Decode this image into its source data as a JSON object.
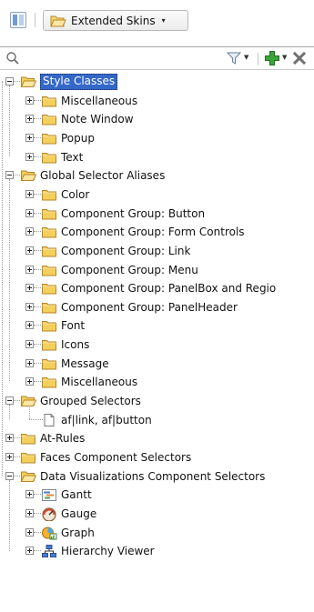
{
  "toolbar": {
    "skin_label": "Extended Skins",
    "dropdown_caret": "▾"
  },
  "search": {
    "placeholder": "",
    "value": ""
  },
  "colors": {
    "selection": "#3468c8",
    "folder": "#f0c64a",
    "add": "#2f9a2f",
    "delete": "#6f6f6f"
  },
  "tree": [
    {
      "label": "Style Classes",
      "level": 0,
      "expander": "minus",
      "icon": "folder-open-icon",
      "selected": true
    },
    {
      "label": "Miscellaneous",
      "level": 1,
      "expander": "plus",
      "icon": "folder-icon"
    },
    {
      "label": "Note Window",
      "level": 1,
      "expander": "plus",
      "icon": "folder-icon"
    },
    {
      "label": "Popup",
      "level": 1,
      "expander": "plus",
      "icon": "folder-icon"
    },
    {
      "label": "Text",
      "level": 1,
      "expander": "plus",
      "icon": "folder-icon"
    },
    {
      "label": "Global Selector Aliases",
      "level": 0,
      "expander": "minus",
      "icon": "folder-open-icon"
    },
    {
      "label": "Color",
      "level": 1,
      "expander": "plus",
      "icon": "folder-icon"
    },
    {
      "label": "Component Group: Button",
      "level": 1,
      "expander": "plus",
      "icon": "folder-icon"
    },
    {
      "label": "Component Group: Form Controls",
      "level": 1,
      "expander": "plus",
      "icon": "folder-icon"
    },
    {
      "label": "Component Group: Link",
      "level": 1,
      "expander": "plus",
      "icon": "folder-icon"
    },
    {
      "label": "Component Group: Menu",
      "level": 1,
      "expander": "plus",
      "icon": "folder-icon"
    },
    {
      "label": "Component Group: PanelBox and Regio",
      "level": 1,
      "expander": "plus",
      "icon": "folder-icon"
    },
    {
      "label": "Component Group: PanelHeader",
      "level": 1,
      "expander": "plus",
      "icon": "folder-icon"
    },
    {
      "label": "Font",
      "level": 1,
      "expander": "plus",
      "icon": "folder-icon"
    },
    {
      "label": "Icons",
      "level": 1,
      "expander": "plus",
      "icon": "folder-icon"
    },
    {
      "label": "Message",
      "level": 1,
      "expander": "plus",
      "icon": "folder-icon"
    },
    {
      "label": "Miscellaneous",
      "level": 1,
      "expander": "plus",
      "icon": "folder-icon"
    },
    {
      "label": "Grouped Selectors",
      "level": 0,
      "expander": "minus",
      "icon": "folder-open-icon"
    },
    {
      "label": "af|link, af|button",
      "level": 1,
      "expander": "none",
      "icon": "file-icon"
    },
    {
      "label": "At-Rules",
      "level": 0,
      "expander": "plus",
      "icon": "folder-icon"
    },
    {
      "label": "Faces Component Selectors",
      "level": 0,
      "expander": "plus",
      "icon": "folder-icon"
    },
    {
      "label": "Data Visualizations Component Selectors",
      "level": 0,
      "expander": "minus",
      "icon": "folder-open-icon"
    },
    {
      "label": "Gantt",
      "level": 1,
      "expander": "plus",
      "icon": "gantt-icon"
    },
    {
      "label": "Gauge",
      "level": 1,
      "expander": "plus",
      "icon": "gauge-icon"
    },
    {
      "label": "Graph",
      "level": 1,
      "expander": "plus",
      "icon": "graph-icon"
    },
    {
      "label": "Hierarchy Viewer",
      "level": 1,
      "expander": "plus",
      "icon": "hierarchy-viewer-icon"
    }
  ]
}
